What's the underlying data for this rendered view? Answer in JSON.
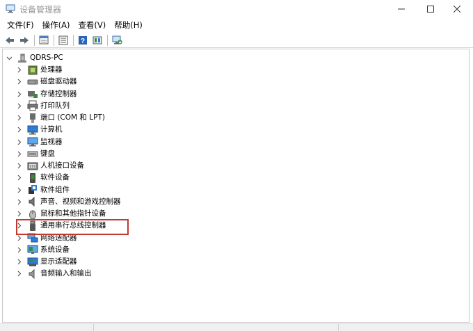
{
  "window": {
    "title": "设备管理器"
  },
  "menu": [
    "文件(F)",
    "操作(A)",
    "查看(V)",
    "帮助(H)"
  ],
  "toolbar": {
    "buttons": [
      "back-arrow-icon",
      "forward-arrow-icon",
      "properties-icon",
      "list-view-icon",
      "help-icon",
      "driver-update-icon",
      "monitor-scan-icon"
    ]
  },
  "tree": {
    "root": "QDRS-PC",
    "items": [
      {
        "label": "处理器",
        "icon": "processor-icon"
      },
      {
        "label": "磁盘驱动器",
        "icon": "disk-drive-icon"
      },
      {
        "label": "存储控制器",
        "icon": "storage-controller-icon"
      },
      {
        "label": "打印队列",
        "icon": "printer-icon"
      },
      {
        "label": "端口 (COM 和 LPT)",
        "icon": "port-icon"
      },
      {
        "label": "计算机",
        "icon": "computer-icon"
      },
      {
        "label": "监视器",
        "icon": "monitor-icon"
      },
      {
        "label": "键盘",
        "icon": "keyboard-icon"
      },
      {
        "label": "人机接口设备",
        "icon": "hid-icon"
      },
      {
        "label": "软件设备",
        "icon": "software-device-icon"
      },
      {
        "label": "软件组件",
        "icon": "software-component-icon"
      },
      {
        "label": "声音、视频和游戏控制器",
        "icon": "sound-icon"
      },
      {
        "label": "鼠标和其他指针设备",
        "icon": "mouse-icon"
      },
      {
        "label": "通用串行总线控制器",
        "icon": "usb-icon"
      },
      {
        "label": "网络适配器",
        "icon": "network-adapter-icon"
      },
      {
        "label": "系统设备",
        "icon": "system-device-icon"
      },
      {
        "label": "显示适配器",
        "icon": "display-adapter-icon"
      },
      {
        "label": "音频输入和输出",
        "icon": "audio-io-icon"
      }
    ],
    "highlighted_index": 13
  },
  "colors": {
    "highlight_border": "#c0392b",
    "icon_blue": "#2d7dd2",
    "icon_green": "#3a8a3a"
  }
}
